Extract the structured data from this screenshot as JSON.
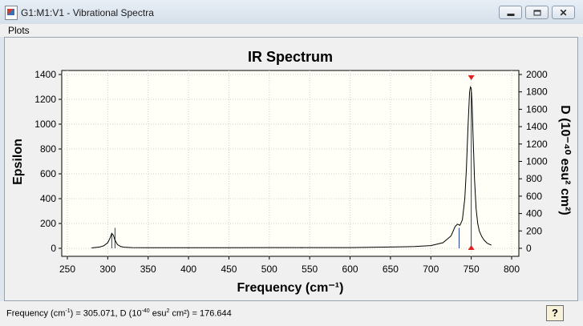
{
  "window": {
    "title": "G1:M1:V1 - Vibrational Spectra",
    "buttons": [
      "minimize-icon",
      "restore-icon",
      "close-icon"
    ]
  },
  "menu": {
    "items": [
      "Plots"
    ]
  },
  "status": {
    "prefix": "Frequency (cm",
    "sup1": "-1",
    "mid1": ") = 305.071, D (10",
    "sup2": "-40",
    "mid2": " esu",
    "sup3": "2",
    "suffix": " cm²) = 176.644",
    "help_label": "?"
  },
  "colors": {
    "plot_bg": "#fffff8",
    "marker": "#e02020",
    "line": "#000000"
  },
  "chart_data": {
    "type": "line",
    "title": "IR Spectrum",
    "xlabel": "Frequency (cm⁻¹)",
    "ylabel_left": "Epsilon",
    "ylabel_right": "D (10⁻⁴⁰ esu² cm²)",
    "xlim": [
      250,
      800
    ],
    "ylim_left": [
      0,
      1400
    ],
    "ylim_right": [
      0,
      2000
    ],
    "x_ticks": [
      250,
      300,
      350,
      400,
      450,
      500,
      550,
      600,
      650,
      700,
      750,
      800
    ],
    "y_ticks_left": [
      0,
      200,
      400,
      600,
      800,
      1000,
      1200,
      1400
    ],
    "y_ticks_right": [
      0,
      200,
      400,
      600,
      800,
      1000,
      1200,
      1400,
      1600,
      1800,
      2000
    ],
    "grid": true,
    "spectrum": {
      "x": [
        280,
        290,
        295,
        300,
        303,
        305,
        307,
        309,
        312,
        316,
        320,
        330,
        350,
        400,
        450,
        500,
        550,
        600,
        650,
        680,
        700,
        715,
        725,
        730,
        733,
        736,
        739,
        742,
        744,
        746,
        748,
        749,
        750,
        751,
        752,
        754,
        756,
        758,
        760,
        763,
        766,
        770,
        775
      ],
      "y": [
        3,
        10,
        20,
        45,
        85,
        120,
        105,
        65,
        30,
        14,
        9,
        6,
        5,
        5,
        5,
        6,
        6,
        6,
        10,
        14,
        22,
        45,
        100,
        175,
        195,
        185,
        230,
        400,
        640,
        980,
        1260,
        1300,
        1290,
        1180,
        950,
        560,
        320,
        200,
        140,
        95,
        65,
        40,
        25
      ]
    },
    "stick_lines": [
      {
        "x": 305,
        "D": 176.644
      },
      {
        "x": 309,
        "D": 235
      },
      {
        "x": 400,
        "D": 6
      },
      {
        "x": 540,
        "D": 10
      },
      {
        "x": 735,
        "D": 235
      },
      {
        "x": 750,
        "D": 1800
      }
    ],
    "selected_frequency": 750
  }
}
